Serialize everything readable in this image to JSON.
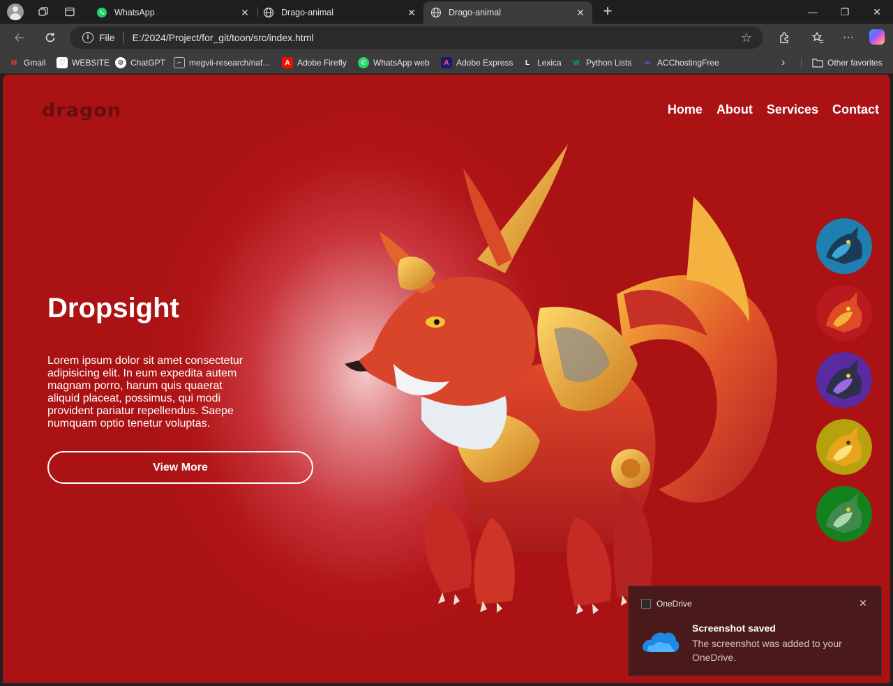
{
  "browser": {
    "tabs": [
      {
        "title": "WhatsApp",
        "icon": "whatsapp-icon",
        "active": false
      },
      {
        "title": "Drago-animal",
        "icon": "globe-icon",
        "active": false
      },
      {
        "title": "Drago-animal",
        "icon": "globe-icon",
        "active": true
      }
    ],
    "window_controls": {
      "minimize": "—",
      "restore": "❐",
      "close": "✕"
    },
    "address": {
      "scheme": "File",
      "url": "E:/2024/Project/for_git/toon/src/index.html"
    },
    "bookmarks": [
      {
        "label": "Gmail",
        "icon": "gmail-icon",
        "color": "#ea4335"
      },
      {
        "label": "WEBSITE",
        "icon": "website-icon",
        "color": "#6e56cf"
      },
      {
        "label": "ChatGPT",
        "icon": "chatgpt-icon",
        "color": "#ffffff"
      },
      {
        "label": "megvii-research/naf...",
        "icon": "bracket-icon",
        "color": "#cccccc"
      },
      {
        "label": "Adobe Firefly",
        "icon": "adobe-icon",
        "color": "#eb1000"
      },
      {
        "label": "WhatsApp web",
        "icon": "whatsapp-icon",
        "color": "#25d366"
      },
      {
        "label": "Adobe Express",
        "icon": "adobe-express-icon",
        "color": "#1a1a6e"
      },
      {
        "label": "Lexica",
        "icon": "lexica-icon",
        "color": "#ffffff"
      },
      {
        "label": "Python Lists",
        "icon": "w3-icon",
        "color": "#04aa6d"
      },
      {
        "label": "ACChostingFree",
        "icon": "acc-icon",
        "color": "#7a5cff"
      }
    ],
    "other_favorites": "Other favorites"
  },
  "page": {
    "logo": "dragon",
    "nav": [
      "Home",
      "About",
      "Services",
      "Contact"
    ],
    "hero": {
      "title": "Dropsight",
      "text": "Lorem ipsum dolor sit amet consectetur adipisicing elit. In eum expedita autem magnam porro, harum quis quaerat aliquid placeat, possimus, qui modi provident pariatur repellendus. Saepe numquam optio tenetur voluptas.",
      "button": "View More"
    },
    "thumbnails": [
      {
        "name": "blue-dragon",
        "color": "#1f7fb0"
      },
      {
        "name": "red-dragon",
        "color": "#b81a1d"
      },
      {
        "name": "purple-dragon",
        "color": "#5a2aa0"
      },
      {
        "name": "yellow-dragon",
        "color": "#b8a10e"
      },
      {
        "name": "green-dragon",
        "color": "#13821c"
      }
    ],
    "colors": {
      "background": "#b01517",
      "accent": "#ffffff"
    }
  },
  "toast": {
    "app": "OneDrive",
    "title": "Screenshot saved",
    "body": "The screenshot was added to your OneDrive."
  }
}
